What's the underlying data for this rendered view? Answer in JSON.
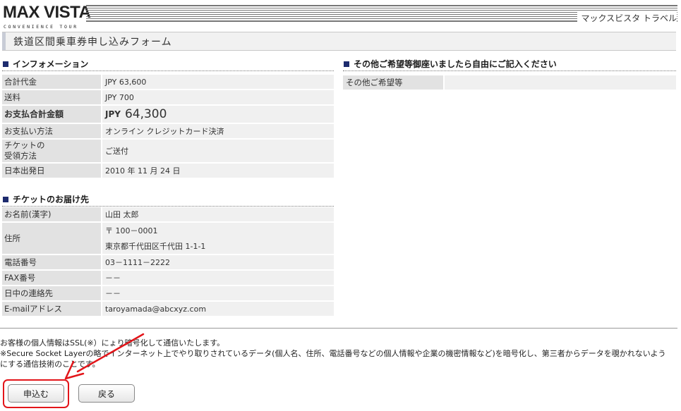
{
  "header": {
    "logo_main": "MAX VISTA",
    "logo_sub": "CONVENIENCE TOUR",
    "site_name": "マックスビスタ トラベル",
    "page_title": "鉄道区間乗車券申し込みフォーム"
  },
  "info_section": {
    "title": "インフォメーション",
    "rows": {
      "total": {
        "label": "合計代金",
        "value": "JPY 63,600"
      },
      "shipping": {
        "label": "送料",
        "value": "JPY 700"
      },
      "payment_total": {
        "label": "お支払合計金額",
        "currency": "JPY",
        "amount": "64,300"
      },
      "payment_method": {
        "label": "お支払い方法",
        "value": "オンライン クレジットカード決済"
      },
      "ticket_receipt": {
        "label_line1": "チケットの",
        "label_line2": "受領方法",
        "value": "ご送付"
      },
      "departure_date": {
        "label": "日本出発日",
        "value": "2010 年 11 月 24 日"
      }
    }
  },
  "delivery_section": {
    "title": "チケットのお届け先",
    "rows": {
      "name": {
        "label": "お名前(漢字)",
        "value": "山田 太郎"
      },
      "address": {
        "label": "住所",
        "postal": "〒 100－0001",
        "line": "東京都千代田区千代田 1-1-1"
      },
      "phone": {
        "label": "電話番号",
        "value": "03－1111－2222"
      },
      "fax": {
        "label": "FAX番号",
        "value": "－－"
      },
      "day_contact": {
        "label": "日中の連絡先",
        "value": "－－"
      },
      "email": {
        "label": "E-mailアドレス",
        "value": "taroyamada@abcxyz.com"
      }
    }
  },
  "requests_section": {
    "title": "その他ご希望等御座いましたら自由にご記入ください",
    "label": "その他ご希望等",
    "value": ""
  },
  "notice": {
    "line1": "お客様の個人情報はSSL(※）にょり暗号化して通信いたします。",
    "line2": "※Secure Socket Layerの略でインターネット上でやり取りされているデータ(個人名、住所、電話番号などの個人情報や企業の機密情報など)を暗号化し、第三者からデータを覗かれないよう",
    "line3": "にする通信技術のことです。"
  },
  "buttons": {
    "submit": "申込む",
    "back": "戻る"
  },
  "colors": {
    "section_marker": "#1d2b6e",
    "label_bg": "#e2e2e2",
    "value_bg": "#f0f0f0",
    "annotation": "#e3151a"
  }
}
